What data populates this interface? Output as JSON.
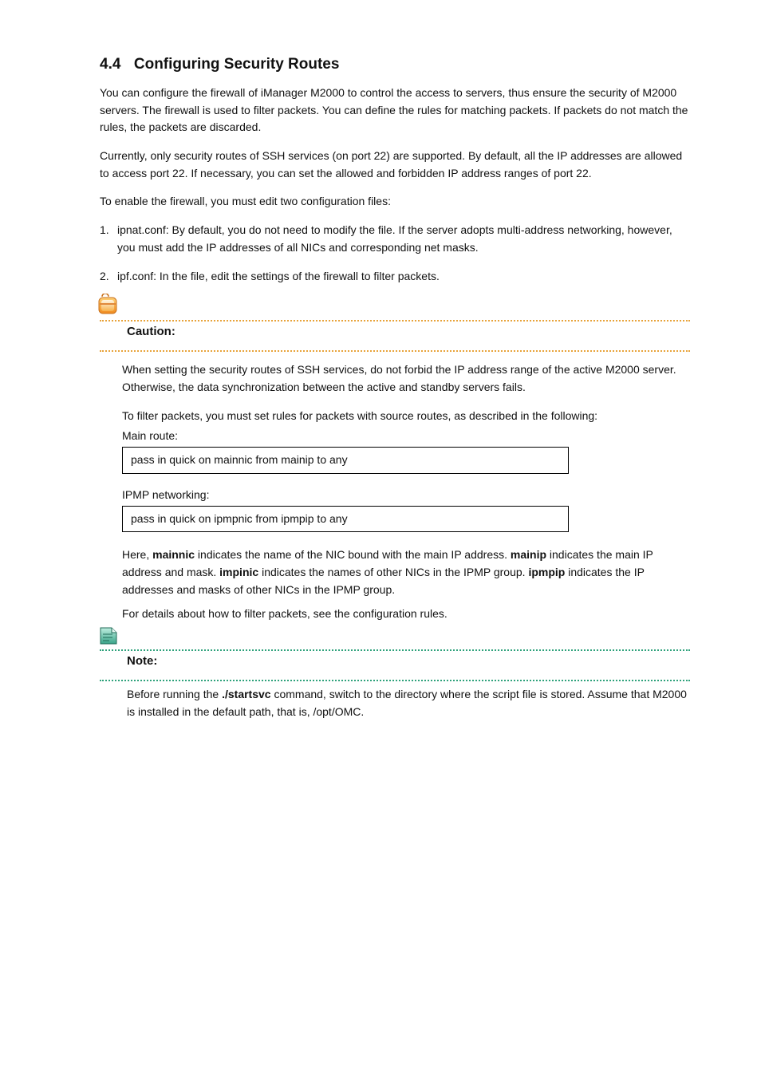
{
  "section": {
    "number": "4.4",
    "title": "Configuring Security Routes"
  },
  "intro": {
    "p1": "You can configure the firewall of iManager M2000 to control the access to servers, thus ensure the security of M2000 servers. The firewall is used to filter packets. You can define the rules for matching packets. If packets do not match the rules, the packets are discarded.",
    "p2": "Currently, only security routes of SSH services (on port 22) are supported. By default, all the IP addresses are allowed to access port 22. If necessary, you can set the allowed and forbidden IP address ranges of port 22.",
    "p3": "To enable the firewall, you must edit two configuration files:"
  },
  "files": {
    "item1_label": "1.",
    "item1_text": "ipnat.conf: By default, you do not need to modify the file. If the server adopts multi-address networking, however, you must add the IP addresses of all NICs and corresponding net masks.",
    "item2_label": "2.",
    "item2_text": "ipf.conf: In the file, edit the settings of the firewall to filter packets."
  },
  "caution": {
    "label": "Caution:",
    "text": "When setting the security routes of SSH services, do not forbid the IP address range of the active M2000 server. Otherwise, the data synchronization between the active and standby servers fails.",
    "after_heading": "To filter packets, you must set rules for packets with source routes, as described in the following:",
    "route1_label": "Main route:",
    "route1_box": "pass in quick on mainnic from mainip to any",
    "route2_label": "IPMP networking:",
    "route2_box": "pass in quick on ipmpnic from ipmpip to any",
    "after_box_p1_a": "Here, ",
    "after_box_p1_b_bold": "mainnic",
    "after_box_p1_c": " indicates the name of the NIC bound with the main IP address. ",
    "after_box_p1_d_bold": "mainip",
    "after_box_p1_e": " indicates the main IP address and mask. ",
    "after_box_p1_f_bold": "impinic",
    "after_box_p1_g": " indicates the names of other NICs in the IPMP group. ",
    "after_box_p1_h_bold": "ipmpip",
    "after_box_p1_i": " indicates the IP addresses and masks of other NICs in the IPMP group.",
    "after_box_p2": "For details about how to filter packets, see the configuration rules."
  },
  "note": {
    "label": "Note:",
    "text_a": "Before running the ",
    "text_b_bold": ".",
    "text_c_bold2": "/startsvc",
    "text_d": " command, switch to the directory where the script file is stored. Assume that M2000 is installed in the default path, that is, /opt/OMC."
  }
}
